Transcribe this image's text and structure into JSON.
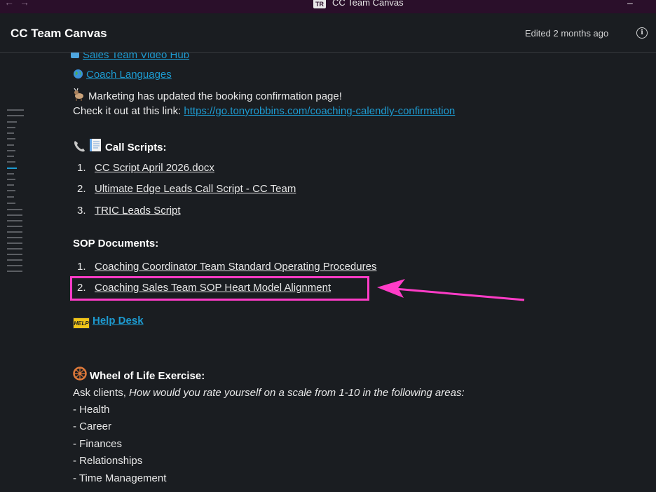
{
  "window": {
    "title": "CC Team Canvas",
    "logo_text": "TR",
    "nav_back": "←",
    "nav_forward": "→",
    "minimize": "–"
  },
  "header": {
    "title": "CC Team Canvas",
    "edited": "Edited 2 months ago",
    "info_icon": "i"
  },
  "content": {
    "video_hub": "Sales Team Video Hub",
    "coach_languages": "Coach Languages ",
    "marketing_line": "Marketing has updated the booking confirmation page!",
    "checkout_text": "Check it out at this link: ",
    "checkout_link": "https://go.tonyrobbins.com/coaching-calendly-confirmation",
    "call_scripts_heading": "Call Scripts:",
    "call_scripts": [
      {
        "num": "1.",
        "label": "CC Script April 2026.docx"
      },
      {
        "num": "2.",
        "label": "Ultimate Edge Leads Call Script - CC Team"
      },
      {
        "num": "3.",
        "label": "TRIC Leads Script"
      }
    ],
    "sop_heading": "SOP Documents:",
    "sop_docs": [
      {
        "num": "1.",
        "label": "Coaching Coordinator Team Standard Operating Procedures "
      },
      {
        "num": "2.",
        "label": "Coaching Sales Team SOP Heart Model Alignment "
      }
    ],
    "help_badge": "HELP",
    "help_desk": "Help Desk ",
    "wheel_heading": "Wheel of Life Exercise:",
    "ask_prefix": "Ask clients, ",
    "ask_question": "How would you rate yourself on a scale from 1-10 in the following areas:",
    "areas": [
      "- Health",
      "- Career",
      "- Finances",
      "- Relationships",
      "- Time Management"
    ]
  },
  "colors": {
    "link": "#1d9bd1",
    "highlight": "#ff3cc7",
    "background": "#1a1d21",
    "titlebar": "#2a0f2a"
  }
}
